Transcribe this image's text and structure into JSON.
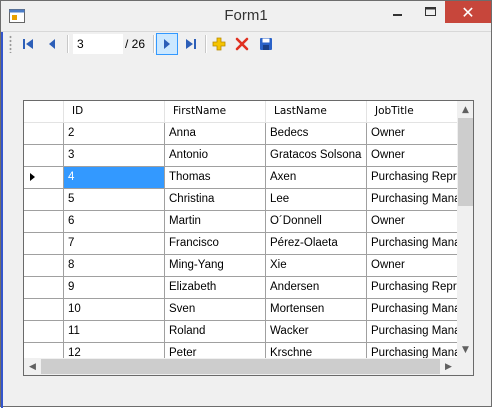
{
  "window": {
    "title": "Form1",
    "minimize": "—",
    "maximize": "□",
    "close": "✕"
  },
  "navigator": {
    "position": "3",
    "count": "/ 26",
    "icons": {
      "first": "move-first-icon",
      "prev": "move-previous-icon",
      "next": "move-next-icon",
      "last": "move-last-icon",
      "add": "add-new-icon",
      "delete": "delete-icon",
      "save": "save-icon"
    },
    "colors": {
      "add": "#e8b400",
      "delete": "#e03020",
      "save": "#2a62c8",
      "nav": "#2d5fb8"
    }
  },
  "grid": {
    "columns": [
      "ID",
      "FirstName",
      "LastName",
      "JobTitle"
    ],
    "current_row_index": 2,
    "rows": [
      {
        "id": "2",
        "first": "Anna",
        "last": "Bedecs",
        "job": "Owner"
      },
      {
        "id": "3",
        "first": "Antonio",
        "last": "Gratacos Solsona",
        "job": "Owner"
      },
      {
        "id": "4",
        "first": "Thomas",
        "last": "Axen",
        "job": "Purchasing Repr..."
      },
      {
        "id": "5",
        "first": "Christina",
        "last": "Lee",
        "job": "Purchasing Mana..."
      },
      {
        "id": "6",
        "first": "Martin",
        "last": "O´Donnell",
        "job": "Owner"
      },
      {
        "id": "7",
        "first": "Francisco",
        "last": "Pérez-Olaeta",
        "job": "Purchasing Mana..."
      },
      {
        "id": "8",
        "first": "Ming-Yang",
        "last": "Xie",
        "job": "Owner"
      },
      {
        "id": "9",
        "first": "Elizabeth",
        "last": "Andersen",
        "job": "Purchasing Repr..."
      },
      {
        "id": "10",
        "first": "Sven",
        "last": "Mortensen",
        "job": "Purchasing Mana..."
      },
      {
        "id": "11",
        "first": "Roland",
        "last": "Wacker",
        "job": "Purchasing Mana..."
      },
      {
        "id": "12",
        "first": "Peter",
        "last": "Krschne",
        "job": "Purchasing Mana..."
      }
    ]
  }
}
